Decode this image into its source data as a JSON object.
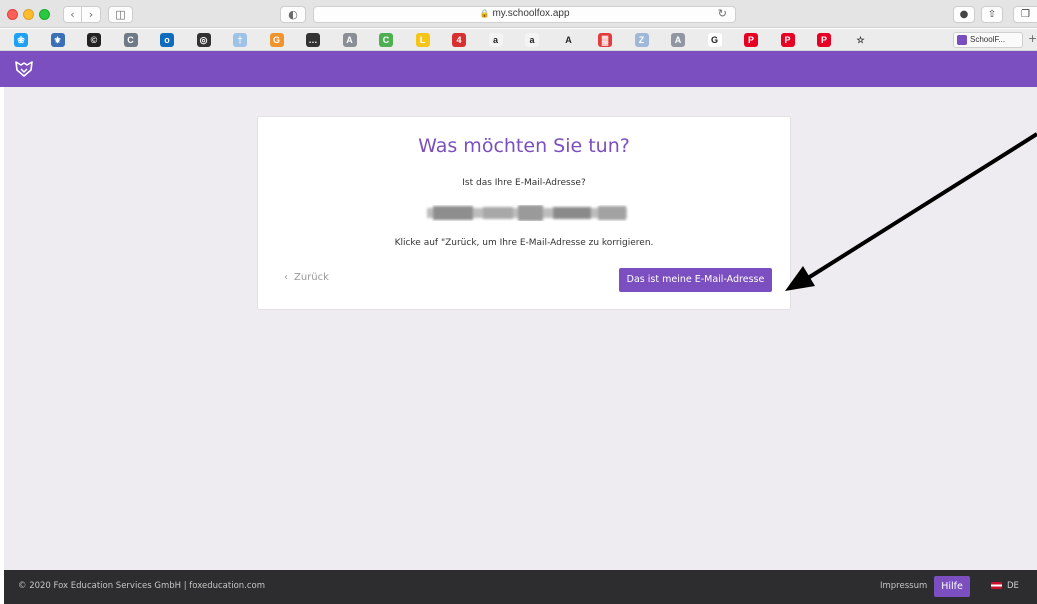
{
  "browser": {
    "address": "my.schoolfox.app",
    "favorites_tab_label": "SchoolF..."
  },
  "favorites": [
    {
      "icon": "twitter-icon",
      "color": "#1da1f2",
      "glyph": "❀"
    },
    {
      "icon": "fav-blue-icon",
      "color": "#3b6fb6",
      "glyph": "⚜"
    },
    {
      "icon": "cc-icon",
      "color": "#222222",
      "glyph": "©"
    },
    {
      "icon": "c-icon",
      "color": "#6f7a86",
      "glyph": "C"
    },
    {
      "icon": "outlook-icon",
      "color": "#0f6cbd",
      "glyph": "o"
    },
    {
      "icon": "instagram-icon",
      "color": "#333333",
      "glyph": "◎"
    },
    {
      "icon": "bottle-icon",
      "color": "#9fc3e6",
      "glyph": "†"
    },
    {
      "icon": "g-orange-icon",
      "color": "#f0932b",
      "glyph": "G"
    },
    {
      "icon": "dots-icon",
      "color": "#333333",
      "glyph": "…"
    },
    {
      "icon": "a-gray-icon",
      "color": "#8a8f96",
      "glyph": "A"
    },
    {
      "icon": "c-green-icon",
      "color": "#4caf50",
      "glyph": "C"
    },
    {
      "icon": "lidl-icon",
      "color": "#f5c518",
      "glyph": "L"
    },
    {
      "icon": "flag-red-icon",
      "color": "#d63031",
      "glyph": "4"
    },
    {
      "icon": "amazon-icon",
      "color": "#f4f4f4",
      "glyph": "a"
    },
    {
      "icon": "amazon2-icon",
      "color": "#f4f4f4",
      "glyph": "a"
    },
    {
      "icon": "a-serif-icon",
      "color": "#ececec",
      "glyph": "A"
    },
    {
      "icon": "grid-red-icon",
      "color": "#e23c3c",
      "glyph": "▓"
    },
    {
      "icon": "x-icon",
      "color": "#a0b8d8",
      "glyph": "Z"
    },
    {
      "icon": "a-box-icon",
      "color": "#9097a0",
      "glyph": "A"
    },
    {
      "icon": "google-icon",
      "color": "#ffffff",
      "glyph": "G"
    },
    {
      "icon": "pinterest-icon",
      "color": "#e60023",
      "glyph": "P"
    },
    {
      "icon": "pinterest2-icon",
      "color": "#e60023",
      "glyph": "P"
    },
    {
      "icon": "pinterest3-icon",
      "color": "#e60023",
      "glyph": "P"
    },
    {
      "icon": "star-icon",
      "color": "#ececec",
      "glyph": "☆"
    }
  ],
  "card": {
    "title": "Was möchten Sie tun?",
    "question": "Ist das Ihre E-Mail-Adresse?",
    "hint": "Klicke auf \"Zurück, um Ihre E-Mail-Adresse zu korrigieren.",
    "back_label": "Zurück",
    "confirm_label": "Das ist meine E-Mail-Adresse"
  },
  "footer": {
    "copyright": "© 2020 Fox Education Services GmbH | foxeducation.com",
    "impressum": "Impressum",
    "hilfe": "Hilfe",
    "language": "DE"
  },
  "colors": {
    "brand": "#7b4fbf",
    "page_bg": "#efecf1",
    "footer_bg": "#2d2d2f"
  }
}
